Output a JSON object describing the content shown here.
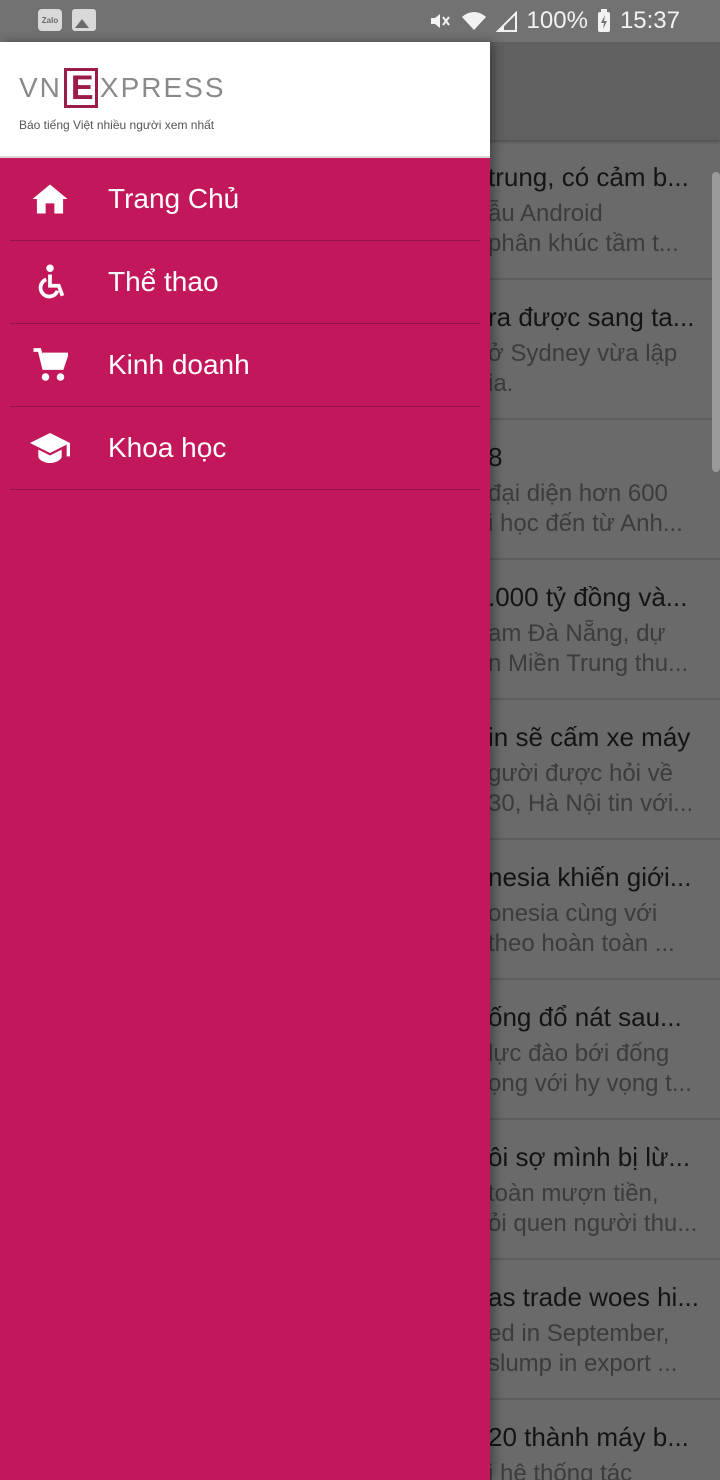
{
  "status_bar": {
    "app_icon_label": "Zalo",
    "battery": "100%",
    "time": "15:37",
    "icons": [
      "zalo-icon",
      "gallery-icon",
      "mute-icon",
      "wifi-icon",
      "signal-icon",
      "battery-charging-icon"
    ]
  },
  "drawer": {
    "logo_left": "VN",
    "logo_mid": "E",
    "logo_right": "XPRESS",
    "tagline": "Báo tiếng Việt nhiều người xem nhất",
    "background_color": "#c2185b",
    "items": [
      {
        "label": "Trang Chủ",
        "icon": "home-icon"
      },
      {
        "label": "Thể thao",
        "icon": "accessible-icon"
      },
      {
        "label": "Kinh doanh",
        "icon": "shopping-cart-icon"
      },
      {
        "label": "Khoa học",
        "icon": "graduation-cap-icon"
      }
    ]
  },
  "articles": [
    {
      "title": "trung, có cảm b...",
      "line1": "ẫu Android",
      "line2": "phân khúc tầm t..."
    },
    {
      "title": "ra được sang ta...",
      "line1": "ở Sydney vừa lập",
      "line2": "ia."
    },
    {
      "title": "8",
      "line1": "đại diện hơn 600",
      "line2": "i học đến từ Anh..."
    },
    {
      "title": ".000 tỷ đồng và...",
      "line1": "am Đà Nẵng, dự",
      "line2": "n Miền Trung thu..."
    },
    {
      "title": "in sẽ cấm xe máy",
      "line1": "gười được hỏi về",
      "line2": "30, Hà Nội tin với..."
    },
    {
      "title": "nesia khiến giới...",
      "line1": "onesia cùng với",
      "line2": "theo hoàn toàn ..."
    },
    {
      "title": "ống đổ nát sau...",
      "line1": "lực đào bới đống",
      "line2": "ọng với hy vọng t..."
    },
    {
      "title": "ôi sợ mình bị lừ...",
      "line1": "toàn mượn tiền,",
      "line2": "ỏi quen người thu..."
    },
    {
      "title": "as trade woes hi...",
      "line1": "ed in September,",
      "line2": "slump in export ..."
    },
    {
      "title": "20 thành máy b...",
      "line1": "i hệ thống tác",
      "line2": ""
    }
  ]
}
